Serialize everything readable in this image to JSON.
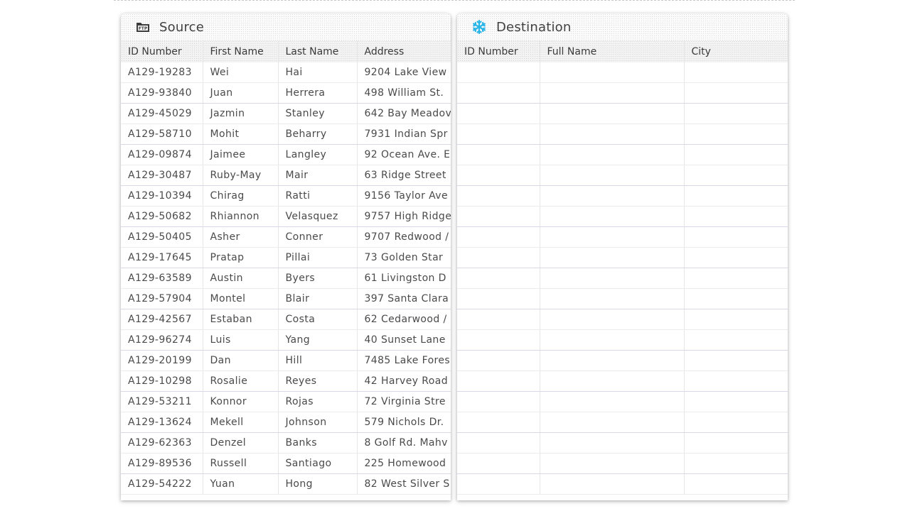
{
  "source": {
    "title": "Source",
    "icon": "ftp-folder-icon",
    "columns": [
      "ID Number",
      "First Name",
      "Last Name",
      "Address"
    ],
    "rows": [
      [
        "A129-19283",
        "Wei",
        "Hai",
        "9204 Lake View"
      ],
      [
        "A129-93840",
        "Juan",
        "Herrera",
        "498 William St."
      ],
      [
        "A129-45029",
        "Jazmin",
        "Stanley",
        "642 Bay Meadov"
      ],
      [
        "A129-58710",
        "Mohit",
        "Beharry",
        "7931 Indian Spr"
      ],
      [
        "A129-09874",
        "Jaimee",
        "Langley",
        "92 Ocean Ave. E"
      ],
      [
        "A129-30487",
        "Ruby-May",
        "Mair",
        "63 Ridge Street"
      ],
      [
        "A129-10394",
        "Chirag",
        "Ratti",
        "9156 Taylor Ave"
      ],
      [
        "A129-50682",
        "Rhiannon",
        "Velasquez",
        "9757 High Ridge"
      ],
      [
        "A129-50405",
        "Asher",
        "Conner",
        "9707 Redwood /"
      ],
      [
        "A129-17645",
        "Pratap",
        "Pillai",
        "73 Golden Star"
      ],
      [
        "A129-63589",
        "Austin",
        "Byers",
        "61 Livingston D"
      ],
      [
        "A129-57904",
        "Montel",
        "Blair",
        "397 Santa Clara"
      ],
      [
        "A129-42567",
        "Estaban",
        "Costa",
        "62 Cedarwood /"
      ],
      [
        "A129-96274",
        "Luis",
        "Yang",
        "40 Sunset Lane"
      ],
      [
        "A129-20199",
        "Dan",
        "Hill",
        "7485 Lake Fores"
      ],
      [
        "A129-10298",
        "Rosalie",
        "Reyes",
        "42 Harvey Road"
      ],
      [
        "A129-53211",
        "Konnor",
        "Rojas",
        "72 Virginia Stre"
      ],
      [
        "A129-13624",
        "Mekell",
        "Johnson",
        "579 Nichols Dr."
      ],
      [
        "A129-62363",
        "Denzel",
        "Banks",
        "8 Golf Rd. Mahv"
      ],
      [
        "A129-89536",
        "Russell",
        "Santiago",
        "225 Homewood"
      ],
      [
        "A129-54222",
        "Yuan",
        "Hong",
        "82 West Silver S"
      ]
    ]
  },
  "destination": {
    "title": "Destination",
    "icon": "snowflake-icon",
    "columns": [
      "ID Number",
      "Full Name",
      "City"
    ],
    "row_count": 21
  },
  "colors": {
    "snowflake": "#29b5e8",
    "text": "#4a4a4a"
  }
}
